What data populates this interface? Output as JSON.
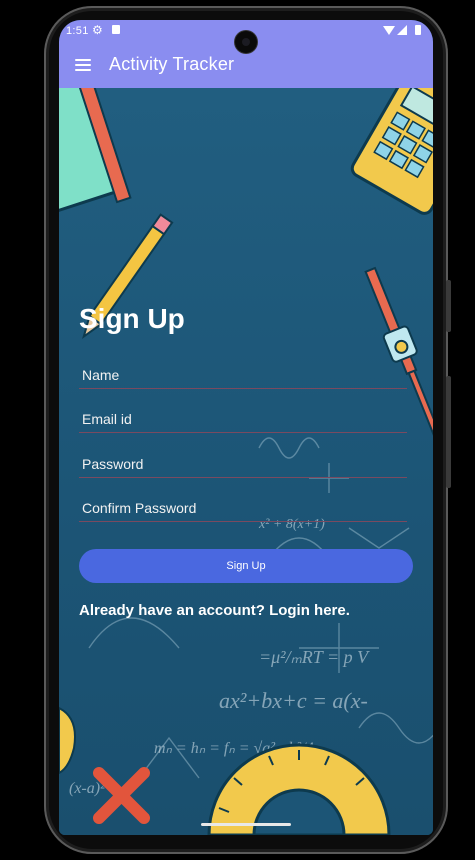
{
  "status_bar": {
    "time": "1:51",
    "icons": [
      "gear-icon",
      "sd-card-icon",
      "wifi-icon",
      "signal-icon",
      "battery-icon"
    ]
  },
  "app_bar": {
    "title": "Activity Tracker",
    "menu_icon": "hamburger-menu-icon"
  },
  "form": {
    "title": "Sign Up",
    "name_placeholder": "Name",
    "email_placeholder": "Email id",
    "password_placeholder": "Password",
    "confirm_password_placeholder": "Confirm Password",
    "signup_button": "Sign Up",
    "login_link": "Already have an account? Login here."
  },
  "colors": {
    "app_bar": "#8a8df0",
    "button": "#4a68e0",
    "background": "#1c5576"
  }
}
